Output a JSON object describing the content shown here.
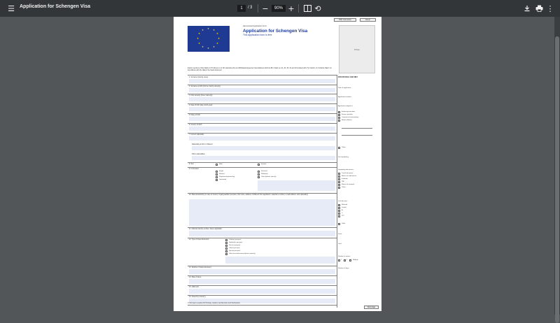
{
  "toolbar": {
    "title": "Application for Schengen Visa",
    "current_page": "1",
    "page_separator": "/",
    "total_pages": "3",
    "zoom": "90%"
  },
  "form": {
    "buttons": {
      "print_instructions": "PDF Instruction",
      "reset": "Reset"
    },
    "header": {
      "harmonised": "Harmonised Application Form",
      "title": "Application for Schengen Visa",
      "subtitle": "This application form is free",
      "photo": "Photo"
    },
    "notice": "Family members of EU, EEA or CH citizens or of UK nationals who are Withdrawal Agreement beneficiaries shall not fill in fields no. 21, 22, 30, 31 and 32 (marked with (*)). Fields 1 to 3 shall be filled in in accordance with the data in the travel document.",
    "fields": [
      "1. Surname (Family name):",
      "2. Surname at birth (Former family name(s)):",
      "3. First name(s) (Given name(s)):",
      "4. Date of birth (day-month-year):",
      "5. Place of birth:",
      "6. Country of birth:",
      "7. Current nationality:",
      "Nationality at birth, if different:",
      "Other nationalities:",
      "8. Sex:",
      "9. Civil status:",
      "10. Parental authority (in case of minors) / legal guardian (surname, first name, address, if different from applicant's, telephone number, e-mail address, and nationality):",
      "11. National identity number, where applicable:",
      "12. Type of travel document:",
      "13. Number of travel document:",
      "14. Date of issue:",
      "15. Valid until:",
      "16. Issued by (country):"
    ],
    "sex_options": [
      "Male",
      "Female"
    ],
    "civil_options": [
      "Single",
      "Married",
      "Registered partnership",
      "Separated",
      "Divorced",
      "Widow(er)",
      "Other (please specify)"
    ],
    "doc_options": [
      "Ordinary passport",
      "Diplomatic passport",
      "Service passport",
      "Official passport",
      "Special passport",
      "Other travel document (please specify)"
    ],
    "footnote": "(*) No logo is required for Norway, Iceland, Liechtenstein and Switzerland.",
    "next_page": "Next page"
  },
  "official": {
    "heading": "FOR OFFICIAL USE ONLY",
    "date_of_application": "Date of application:",
    "application_number": "Application number:",
    "lodged_at": "Application lodged at:",
    "lodged_options": [
      "Embassy/consulate",
      "Service provider",
      "Commercial intermediary",
      "Border (Name):"
    ],
    "other": "Other:",
    "file_handled_by": "File handled by:",
    "supporting_documents": "Supporting documents:",
    "supporting_options": [
      "Travel document",
      "Means of subsistence",
      "Invitation",
      "TMI",
      "Means of transport",
      "Other:"
    ],
    "visa_decision": "Visa decision:",
    "decision_options": [
      "Refused",
      "Issued",
      "A",
      "C",
      "LTV",
      "Valid:"
    ],
    "from": "From:",
    "until": "Until:",
    "number_of_entries": "Number of entries:",
    "entries_options": [
      "1",
      "2",
      "Multiple"
    ],
    "number_of_days": "Number of days:"
  }
}
